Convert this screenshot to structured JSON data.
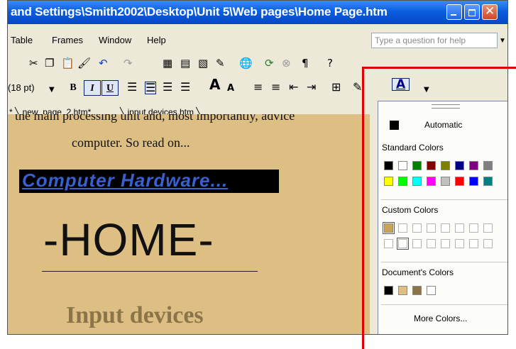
{
  "window": {
    "title": "and Settings\\Smith2002\\Desktop\\Unit 5\\Web pages\\Home Page.htm",
    "minimize_icon": "minimize-icon",
    "maximize_icon": "restore-icon",
    "close_icon": "close-icon"
  },
  "menu": {
    "items": [
      "Table",
      "Frames",
      "Window",
      "Help"
    ],
    "help_placeholder": "Type a question for help"
  },
  "format": {
    "font_size": "(18 pt)",
    "bold": "B",
    "italic": "I",
    "underline": "U"
  },
  "tabs": [
    "new_page_2.htm*",
    "input devices.htm"
  ],
  "document": {
    "line1": "the main processing unit and, most importantly, advice",
    "line2": "computer. So read on...",
    "hardware_heading": "Computer Hardware...",
    "home_heading": "-HOME-",
    "input_heading": "Input devices"
  },
  "color_menu": {
    "automatic": "Automatic",
    "standard_colors_label": "Standard Colors",
    "standard_colors": [
      "#000000",
      "#ffffff",
      "#008000",
      "#800000",
      "#808000",
      "#000080",
      "#800080",
      "#808080",
      "#ffff00",
      "#00ff00",
      "#00ffff",
      "#ff00ff",
      "#c0c0c0",
      "#ff0000",
      "#0000ff",
      "#008080"
    ],
    "custom_colors_label": "Custom Colors",
    "custom_first": "#c9a35a",
    "documents_colors_label": "Document's Colors",
    "documents_colors": [
      "#000000",
      "#ddbf84",
      "#8a7448",
      "#ffffff"
    ],
    "more_colors": "More Colors..."
  }
}
